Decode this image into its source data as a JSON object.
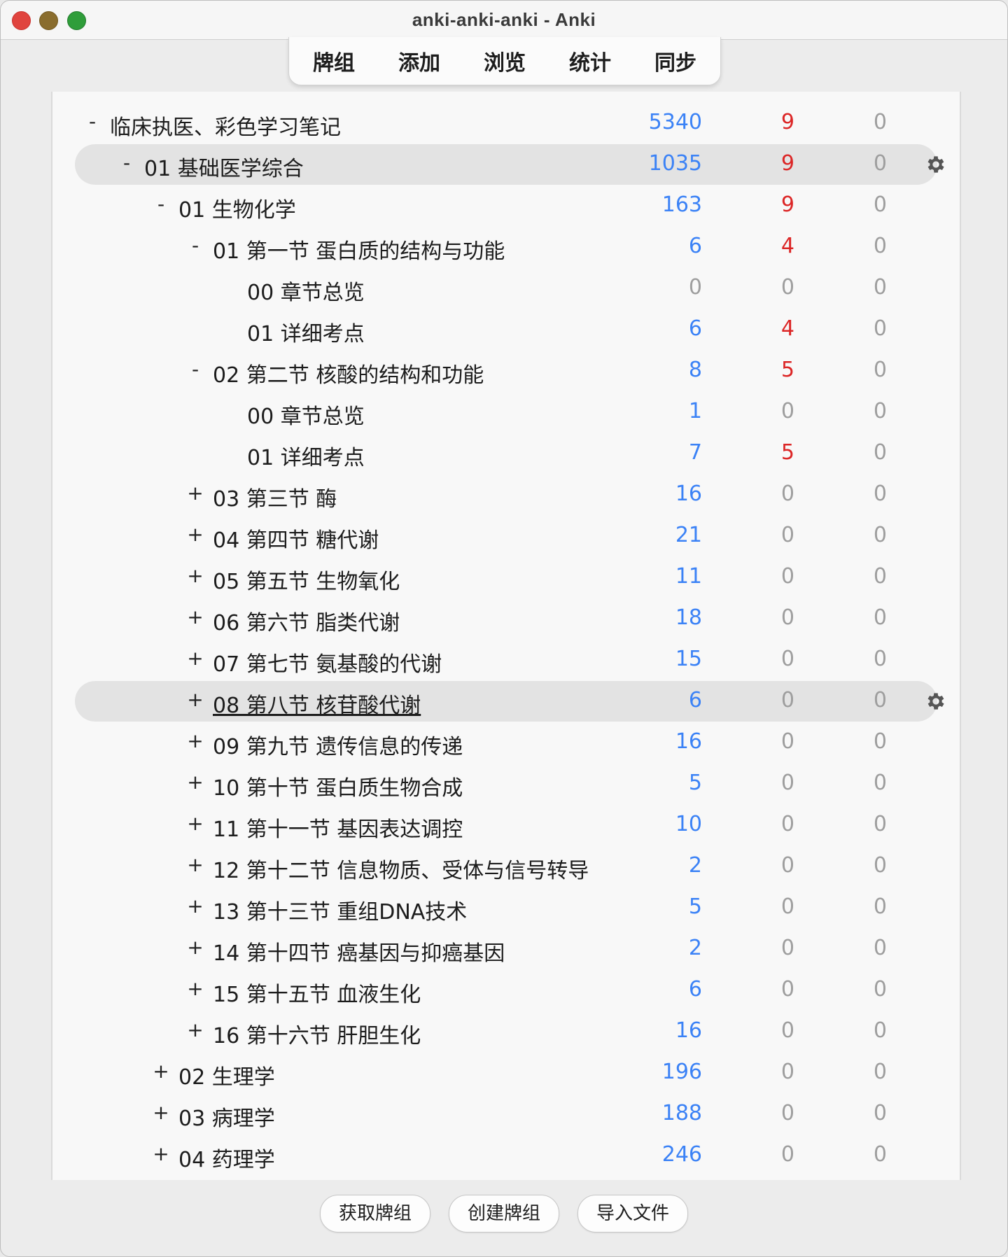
{
  "window": {
    "title": "anki-anki-anki - Anki"
  },
  "toolbar": {
    "items": [
      "牌组",
      "添加",
      "浏览",
      "统计",
      "同步"
    ]
  },
  "decks": [
    {
      "name": "临床执医、彩色学习笔记",
      "expander": "-",
      "level": 0,
      "new": "5340",
      "learn": "9",
      "due": "0",
      "new_color": "blue",
      "learn_color": "red",
      "selected": false
    },
    {
      "name": "01 基础医学综合",
      "expander": "-",
      "level": 1,
      "new": "1035",
      "learn": "9",
      "due": "0",
      "new_color": "blue",
      "learn_color": "red",
      "selected": true
    },
    {
      "name": "01 生物化学",
      "expander": "-",
      "level": 2,
      "new": "163",
      "learn": "9",
      "due": "0",
      "new_color": "blue",
      "learn_color": "red",
      "selected": false
    },
    {
      "name": "01 第一节 蛋白质的结构与功能",
      "expander": "-",
      "level": 3,
      "new": "6",
      "learn": "4",
      "due": "0",
      "new_color": "blue",
      "learn_color": "red",
      "selected": false
    },
    {
      "name": "00 章节总览",
      "expander": "",
      "level": 4,
      "new": "0",
      "learn": "0",
      "due": "0",
      "new_color": "gray",
      "learn_color": "gray",
      "selected": false
    },
    {
      "name": "01 详细考点",
      "expander": "",
      "level": 4,
      "new": "6",
      "learn": "4",
      "due": "0",
      "new_color": "blue",
      "learn_color": "red",
      "selected": false
    },
    {
      "name": "02 第二节 核酸的结构和功能",
      "expander": "-",
      "level": 3,
      "new": "8",
      "learn": "5",
      "due": "0",
      "new_color": "blue",
      "learn_color": "red",
      "selected": false
    },
    {
      "name": "00 章节总览",
      "expander": "",
      "level": 4,
      "new": "1",
      "learn": "0",
      "due": "0",
      "new_color": "blue",
      "learn_color": "gray",
      "selected": false
    },
    {
      "name": "01 详细考点",
      "expander": "",
      "level": 4,
      "new": "7",
      "learn": "5",
      "due": "0",
      "new_color": "blue",
      "learn_color": "red",
      "selected": false
    },
    {
      "name": "03 第三节 酶",
      "expander": "+",
      "level": 3,
      "new": "16",
      "learn": "0",
      "due": "0",
      "new_color": "blue",
      "learn_color": "gray",
      "selected": false
    },
    {
      "name": "04 第四节 糖代谢",
      "expander": "+",
      "level": 3,
      "new": "21",
      "learn": "0",
      "due": "0",
      "new_color": "blue",
      "learn_color": "gray",
      "selected": false
    },
    {
      "name": "05 第五节 生物氧化",
      "expander": "+",
      "level": 3,
      "new": "11",
      "learn": "0",
      "due": "0",
      "new_color": "blue",
      "learn_color": "gray",
      "selected": false
    },
    {
      "name": "06 第六节 脂类代谢",
      "expander": "+",
      "level": 3,
      "new": "18",
      "learn": "0",
      "due": "0",
      "new_color": "blue",
      "learn_color": "gray",
      "selected": false
    },
    {
      "name": "07 第七节 氨基酸的代谢",
      "expander": "+",
      "level": 3,
      "new": "15",
      "learn": "0",
      "due": "0",
      "new_color": "blue",
      "learn_color": "gray",
      "selected": false
    },
    {
      "name": "08 第八节 核苷酸代谢",
      "expander": "+",
      "level": 3,
      "new": "6",
      "learn": "0",
      "due": "0",
      "new_color": "blue",
      "learn_color": "gray",
      "selected": true,
      "link": true
    },
    {
      "name": "09 第九节 遗传信息的传递",
      "expander": "+",
      "level": 3,
      "new": "16",
      "learn": "0",
      "due": "0",
      "new_color": "blue",
      "learn_color": "gray",
      "selected": false
    },
    {
      "name": "10 第十节 蛋白质生物合成",
      "expander": "+",
      "level": 3,
      "new": "5",
      "learn": "0",
      "due": "0",
      "new_color": "blue",
      "learn_color": "gray",
      "selected": false
    },
    {
      "name": "11 第十一节 基因表达调控",
      "expander": "+",
      "level": 3,
      "new": "10",
      "learn": "0",
      "due": "0",
      "new_color": "blue",
      "learn_color": "gray",
      "selected": false
    },
    {
      "name": "12 第十二节 信息物质、受体与信号转导",
      "expander": "+",
      "level": 3,
      "new": "2",
      "learn": "0",
      "due": "0",
      "new_color": "blue",
      "learn_color": "gray",
      "selected": false
    },
    {
      "name": "13 第十三节 重组DNA技术",
      "expander": "+",
      "level": 3,
      "new": "5",
      "learn": "0",
      "due": "0",
      "new_color": "blue",
      "learn_color": "gray",
      "selected": false
    },
    {
      "name": "14 第十四节 癌基因与抑癌基因",
      "expander": "+",
      "level": 3,
      "new": "2",
      "learn": "0",
      "due": "0",
      "new_color": "blue",
      "learn_color": "gray",
      "selected": false
    },
    {
      "name": "15 第十五节 血液生化",
      "expander": "+",
      "level": 3,
      "new": "6",
      "learn": "0",
      "due": "0",
      "new_color": "blue",
      "learn_color": "gray",
      "selected": false
    },
    {
      "name": "16 第十六节 肝胆生化",
      "expander": "+",
      "level": 3,
      "new": "16",
      "learn": "0",
      "due": "0",
      "new_color": "blue",
      "learn_color": "gray",
      "selected": false
    },
    {
      "name": "02 生理学",
      "expander": "+",
      "level": 2,
      "new": "196",
      "learn": "0",
      "due": "0",
      "new_color": "blue",
      "learn_color": "gray",
      "selected": false
    },
    {
      "name": "03 病理学",
      "expander": "+",
      "level": 2,
      "new": "188",
      "learn": "0",
      "due": "0",
      "new_color": "blue",
      "learn_color": "gray",
      "selected": false
    },
    {
      "name": "04 药理学",
      "expander": "+",
      "level": 2,
      "new": "246",
      "learn": "0",
      "due": "0",
      "new_color": "blue",
      "learn_color": "gray",
      "selected": false
    }
  ],
  "bottom": {
    "get_shared": "获取牌组",
    "create_deck": "创建牌组",
    "import_file": "导入文件"
  },
  "colors": {
    "new": "#3b82f6",
    "learn": "#dc2626",
    "zero": "#9e9e9e",
    "selected_row": "#e3e3e3"
  }
}
